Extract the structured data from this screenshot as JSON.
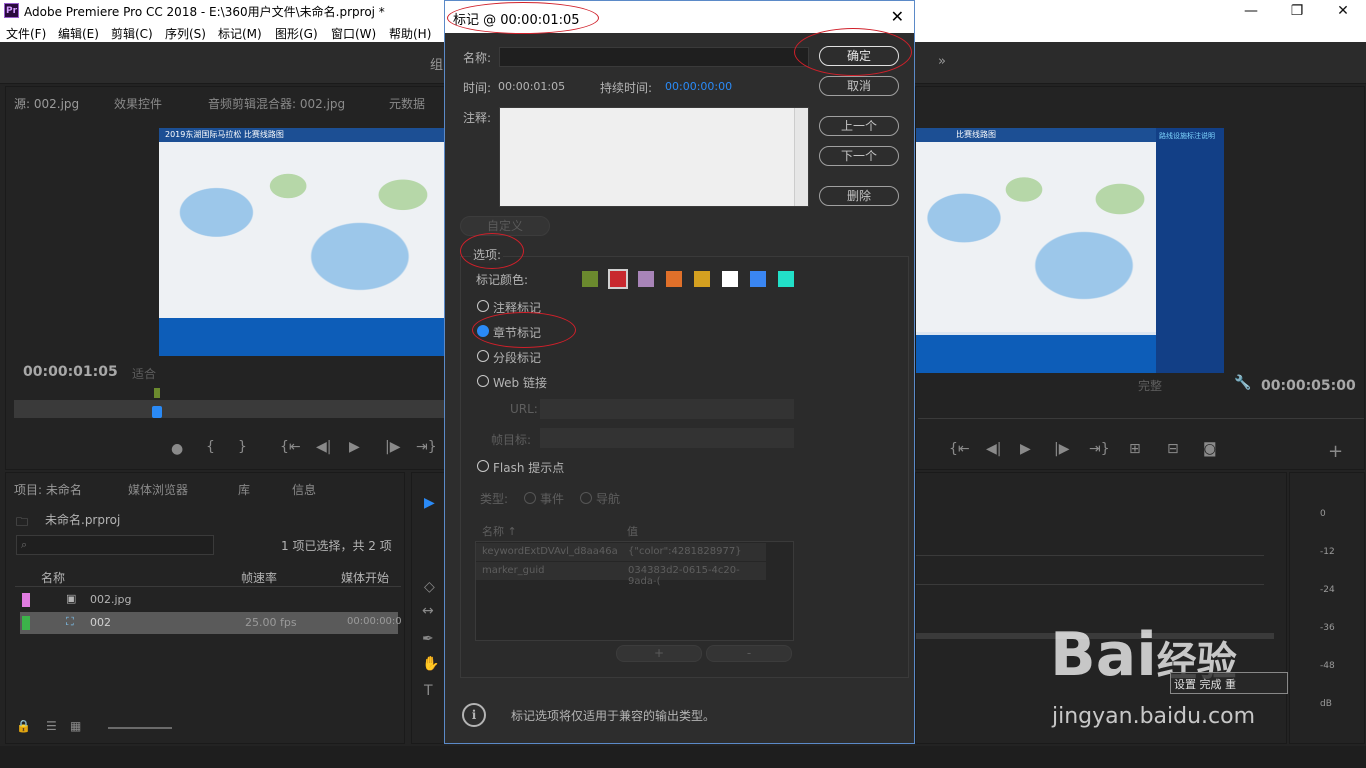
{
  "app": {
    "logo": "Pr",
    "title": "Adobe Premiere Pro CC 2018 - E:\\360用户文件\\未命名.prproj *",
    "window_controls": [
      "—",
      "❐",
      "✕"
    ]
  },
  "menu": [
    "文件(F)",
    "编辑(E)",
    "剪辑(C)",
    "序列(S)",
    "标记(M)",
    "图形(G)",
    "窗口(W)",
    "帮助(H)"
  ],
  "workspace": {
    "tab_left": "组",
    "more": "»"
  },
  "source_panel": {
    "tabs": [
      "源: 002.jpg",
      "效果控件",
      "音频剪辑混合器: 002.jpg",
      "元数据"
    ],
    "frame_header": "2019东湖国际马拉松  比赛线路图",
    "timecode": "00:00:01:05",
    "fit": "适合"
  },
  "program_panel": {
    "frame_header": "比赛线路图",
    "legend_title": "路线设施标注说明",
    "quality": "完整",
    "timecode": "00:00:05:00"
  },
  "project_panel": {
    "tabs": [
      "项目: 未命名",
      "媒体浏览器",
      "库",
      "信息"
    ],
    "project_name": "未命名.prproj",
    "selection": "1 项已选择，共 2 项",
    "columns": [
      "名称",
      "帧速率",
      "媒体开始"
    ],
    "items": [
      {
        "name": "002.jpg",
        "fps": "",
        "start": "",
        "color": "#e07ce0"
      },
      {
        "name": "002",
        "fps": "25.00 fps",
        "start": "00:00:00:0",
        "color": "#3cb44a"
      }
    ]
  },
  "meter": {
    "labels": [
      "0",
      "-12",
      "-24",
      "-36",
      "-48",
      "dB"
    ]
  },
  "dialog": {
    "title": "标记 @ 00:00:01:05",
    "name_label": "名称:",
    "name_value": "",
    "time_label": "时间:",
    "time_value": "00:00:01:05",
    "duration_label": "持续时间:",
    "duration_value": "00:00:00:00",
    "comment_label": "注释:",
    "comment_value": "",
    "buttons": {
      "ok": "确定",
      "cancel": "取消",
      "prev": "上一个",
      "next": "下一个",
      "delete": "删除",
      "custom": "自定义"
    },
    "options_label": "选项:",
    "color_label": "标记颜色:",
    "colors": [
      "#6b8a2e",
      "#c8282e",
      "#a884b8",
      "#e0702a",
      "#d4a020",
      "#ffffff",
      "#3a86f2",
      "#22e0c8"
    ],
    "selected_color_index": 1,
    "marker_types": [
      "注释标记",
      "章节标记",
      "分段标记",
      "Web 链接",
      "Flash 提示点"
    ],
    "selected_type": "章节标记",
    "url_label": "URL:",
    "frame_target_label": "帧目标:",
    "type_label": "类型:",
    "type_event": "事件",
    "type_nav": "导航",
    "table": {
      "col_name": "名称 ↑",
      "col_value": "值",
      "rows": [
        {
          "name": "keywordExtDVAvl_d8aa46a",
          "value": "{\"color\":4281828977}"
        },
        {
          "name": "marker_guid",
          "value": "034383d2-0615-4c20-9ada-("
        }
      ],
      "add": "+",
      "remove": "-"
    },
    "info_text": "标记选项将仅适用于兼容的输出类型。"
  },
  "watermark": {
    "brand": "Bai",
    "brand2": "经验",
    "url": "jingyan.baidu.com",
    "tray_text": "设置 完成 重"
  }
}
